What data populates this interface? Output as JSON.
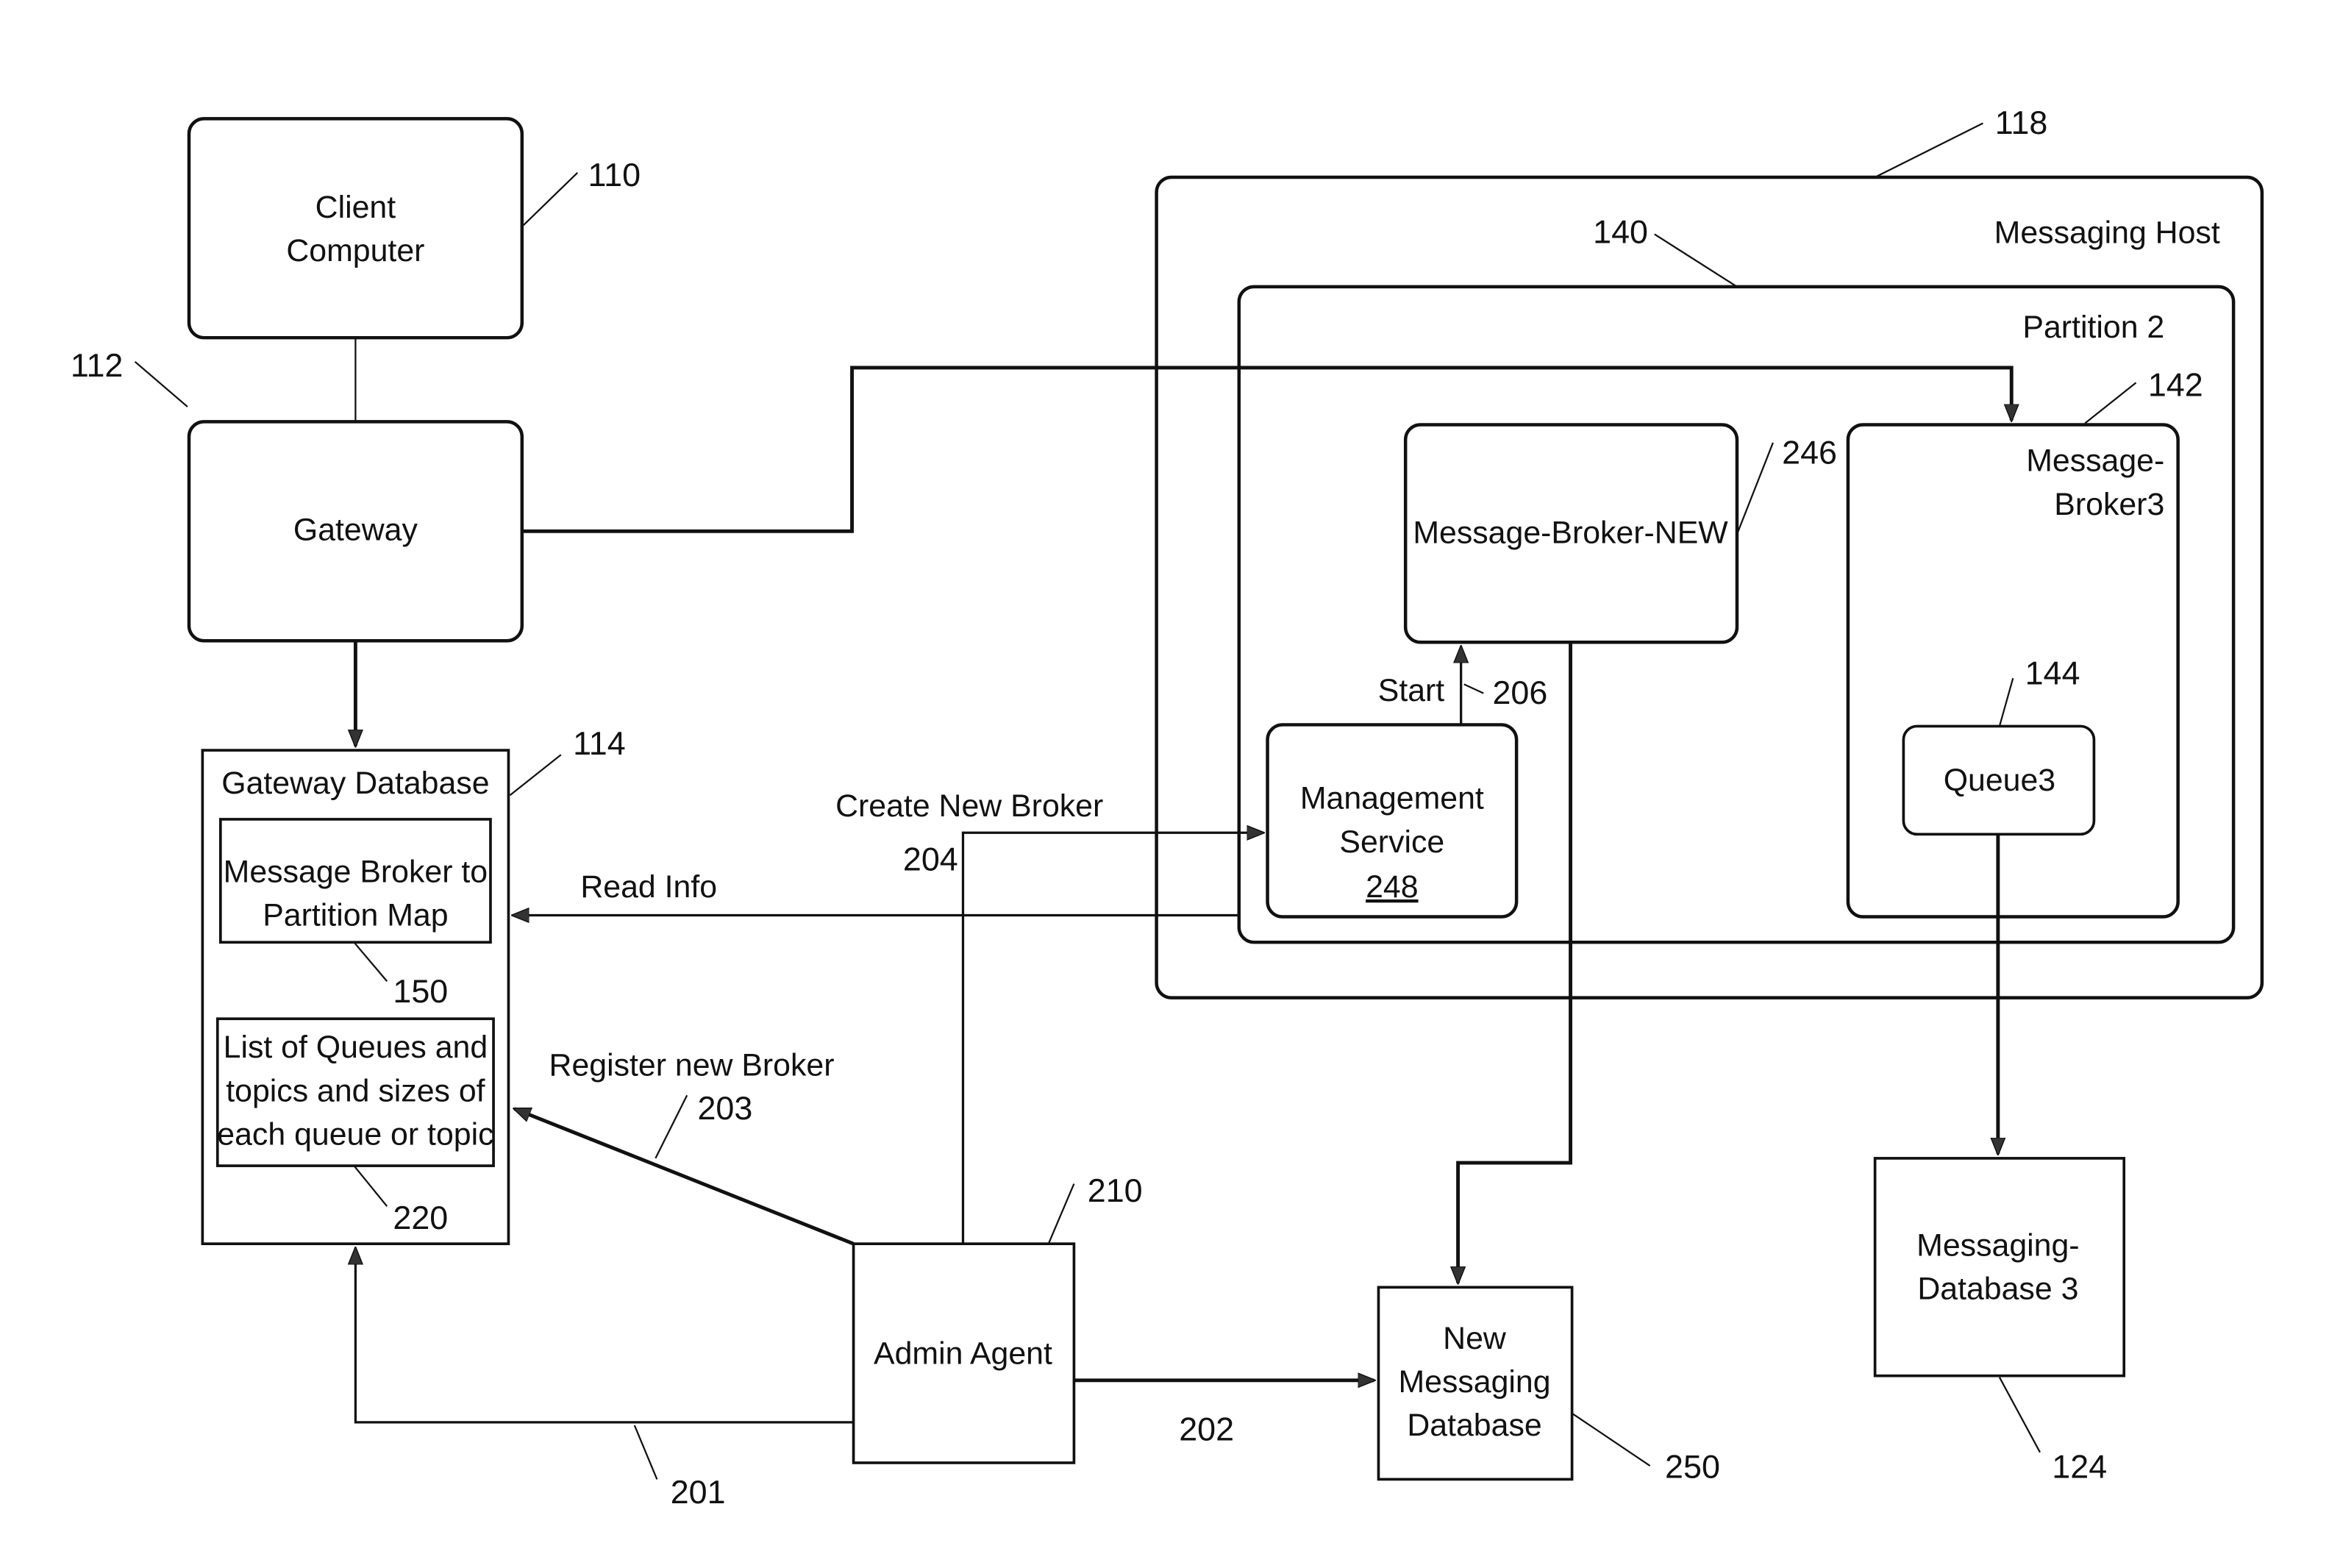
{
  "diagram": {
    "client_computer": {
      "lines": [
        "Client",
        "Computer"
      ],
      "ref": "110"
    },
    "gateway": {
      "label": "Gateway",
      "ref": "112"
    },
    "gateway_database": {
      "title": "Gateway Database",
      "ref": "114",
      "map_box": {
        "lines": [
          "Message Broker to",
          "Partition Map"
        ],
        "ref": "150"
      },
      "list_box": {
        "lines": [
          "List of Queues and",
          "topics and sizes of",
          "each queue or topic"
        ],
        "ref": "220"
      }
    },
    "messaging_host": {
      "label": "Messaging Host",
      "ref": "118"
    },
    "partition": {
      "label": "Partition 2",
      "ref": "140"
    },
    "message_broker_new": {
      "label": "Message-Broker-NEW",
      "ref": "246"
    },
    "message_broker3": {
      "lines": [
        "Message-",
        "Broker3"
      ],
      "ref": "142"
    },
    "management_service": {
      "lines": [
        "Management",
        "Service"
      ],
      "number": "248"
    },
    "queue3": {
      "label": "Queue3",
      "ref": "144"
    },
    "admin_agent": {
      "label": "Admin Agent",
      "ref": "210"
    },
    "new_messaging_database": {
      "lines": [
        "New",
        "Messaging",
        "Database"
      ],
      "ref": "250"
    },
    "messaging_database3": {
      "lines": [
        "Messaging-",
        "Database 3"
      ],
      "ref": "124"
    },
    "arrows": {
      "start": {
        "label": "Start",
        "ref": "206"
      },
      "create_new_broker": {
        "label": "Create New Broker",
        "ref": "204"
      },
      "read_info": {
        "label": "Read Info"
      },
      "register_new_broker": {
        "label": "Register new Broker",
        "ref": "203"
      },
      "to_new_db": {
        "ref": "202"
      },
      "to_gateway_db": {
        "ref": "201"
      }
    }
  }
}
